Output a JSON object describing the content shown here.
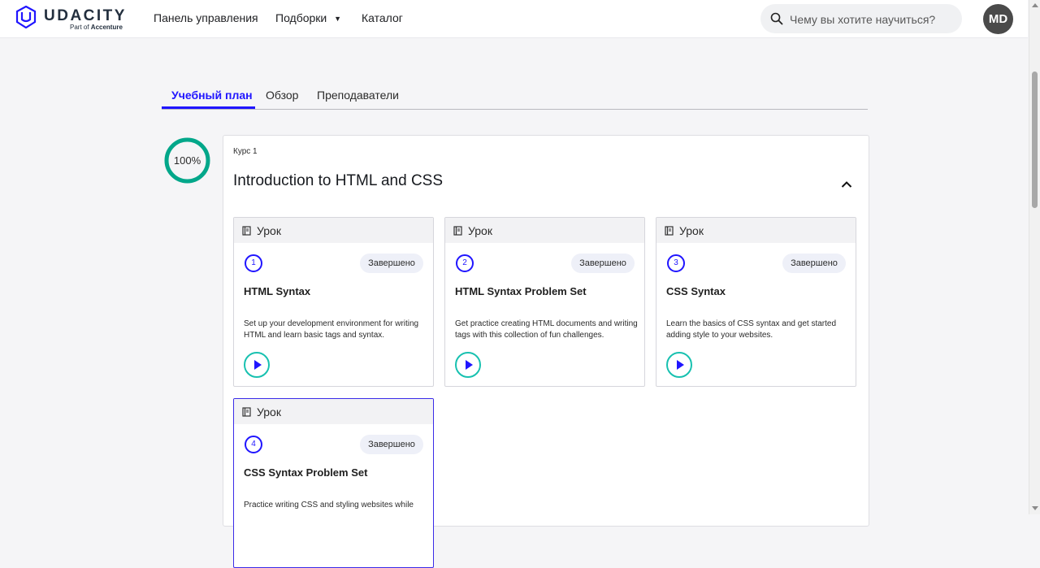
{
  "header": {
    "logo_word": "UDACITY",
    "logo_sub_prefix": "Part of ",
    "logo_sub_brand": "Accenture",
    "nav": {
      "dashboard": "Панель управления",
      "collections": "Подборки",
      "catalog": "Каталог"
    },
    "search_placeholder": "Чему вы хотите научиться?",
    "avatar_initials": "MD"
  },
  "tabs": {
    "curriculum": "Учебный план",
    "overview": "Обзор",
    "instructors": "Преподаватели"
  },
  "progress": {
    "value": 1.0,
    "label": "100%"
  },
  "course": {
    "label": "Курс 1",
    "title": "Introduction to HTML and CSS"
  },
  "lessons": [
    {
      "type": "Урок",
      "number": "1",
      "status": "Завершено",
      "title": "HTML Syntax",
      "description": "Set up your development environment for writing HTML and learn basic tags and syntax."
    },
    {
      "type": "Урок",
      "number": "2",
      "status": "Завершено",
      "title": "HTML Syntax Problem Set",
      "description": "Get practice creating HTML documents and writing tags with this collection of fun challenges."
    },
    {
      "type": "Урок",
      "number": "3",
      "status": "Завершено",
      "title": "CSS Syntax",
      "description": "Learn the basics of CSS syntax and get started adding style to your websites."
    },
    {
      "type": "Урок",
      "number": "4",
      "status": "Завершено",
      "title": "CSS Syntax Problem Set",
      "description": "Practice writing CSS and styling websites while"
    }
  ],
  "colors": {
    "accent": "#2015ff",
    "progress_ring": "#02a78a",
    "play_ring": "#18c1b0"
  }
}
